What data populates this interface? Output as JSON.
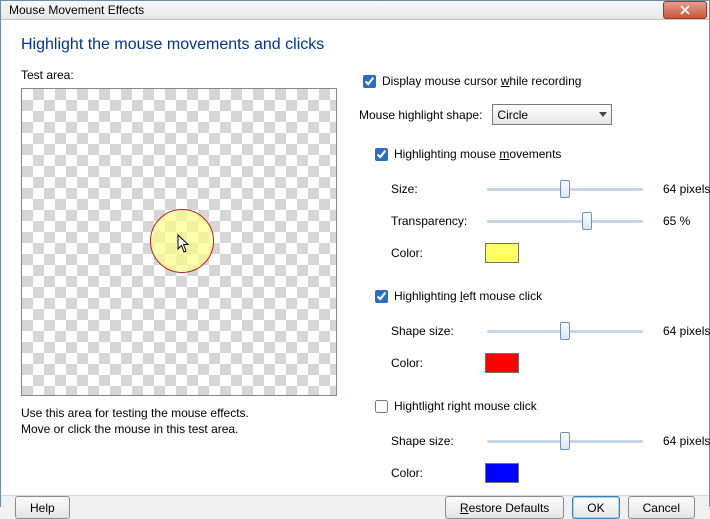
{
  "window": {
    "title": "Mouse Movement Effects"
  },
  "main_title": "Highlight the mouse movements and clicks",
  "left": {
    "test_area_label": "Test area:",
    "hint1": "Use this area for testing the mouse effects.",
    "hint2": "Move or click the mouse in this test area."
  },
  "right": {
    "display_cursor": {
      "checked": true,
      "label_pre": "Display mouse cursor ",
      "label_u": "w",
      "label_post": "hile recording"
    },
    "shape": {
      "label": "Mouse highlight shape:",
      "selected": "Circle"
    },
    "hl_move": {
      "checked": true,
      "label_pre": "Highlighting mouse ",
      "label_u": "m",
      "label_post": "ovements",
      "size_label": "Size:",
      "size_value": "64 pixels",
      "trans_label": "Transparency:",
      "trans_value": "65 %",
      "color_label": "Color:",
      "color": "#ffff66"
    },
    "hl_left": {
      "checked": true,
      "label_pre": "Highlighting ",
      "label_u": "l",
      "label_post": "eft mouse click",
      "size_label": "Shape size:",
      "size_value": "64 pixels",
      "color_label": "Color:",
      "color": "#ff0000"
    },
    "hl_right": {
      "checked": false,
      "label_pre": "Hightlight right mouse click",
      "size_label": "Shape size:",
      "size_value": "64 pixels",
      "color_label": "Color:",
      "color": "#0000ff"
    }
  },
  "footer": {
    "help": "Help",
    "restore_u": "R",
    "restore_post": "estore Defaults",
    "ok": "OK",
    "cancel": "Cancel"
  }
}
